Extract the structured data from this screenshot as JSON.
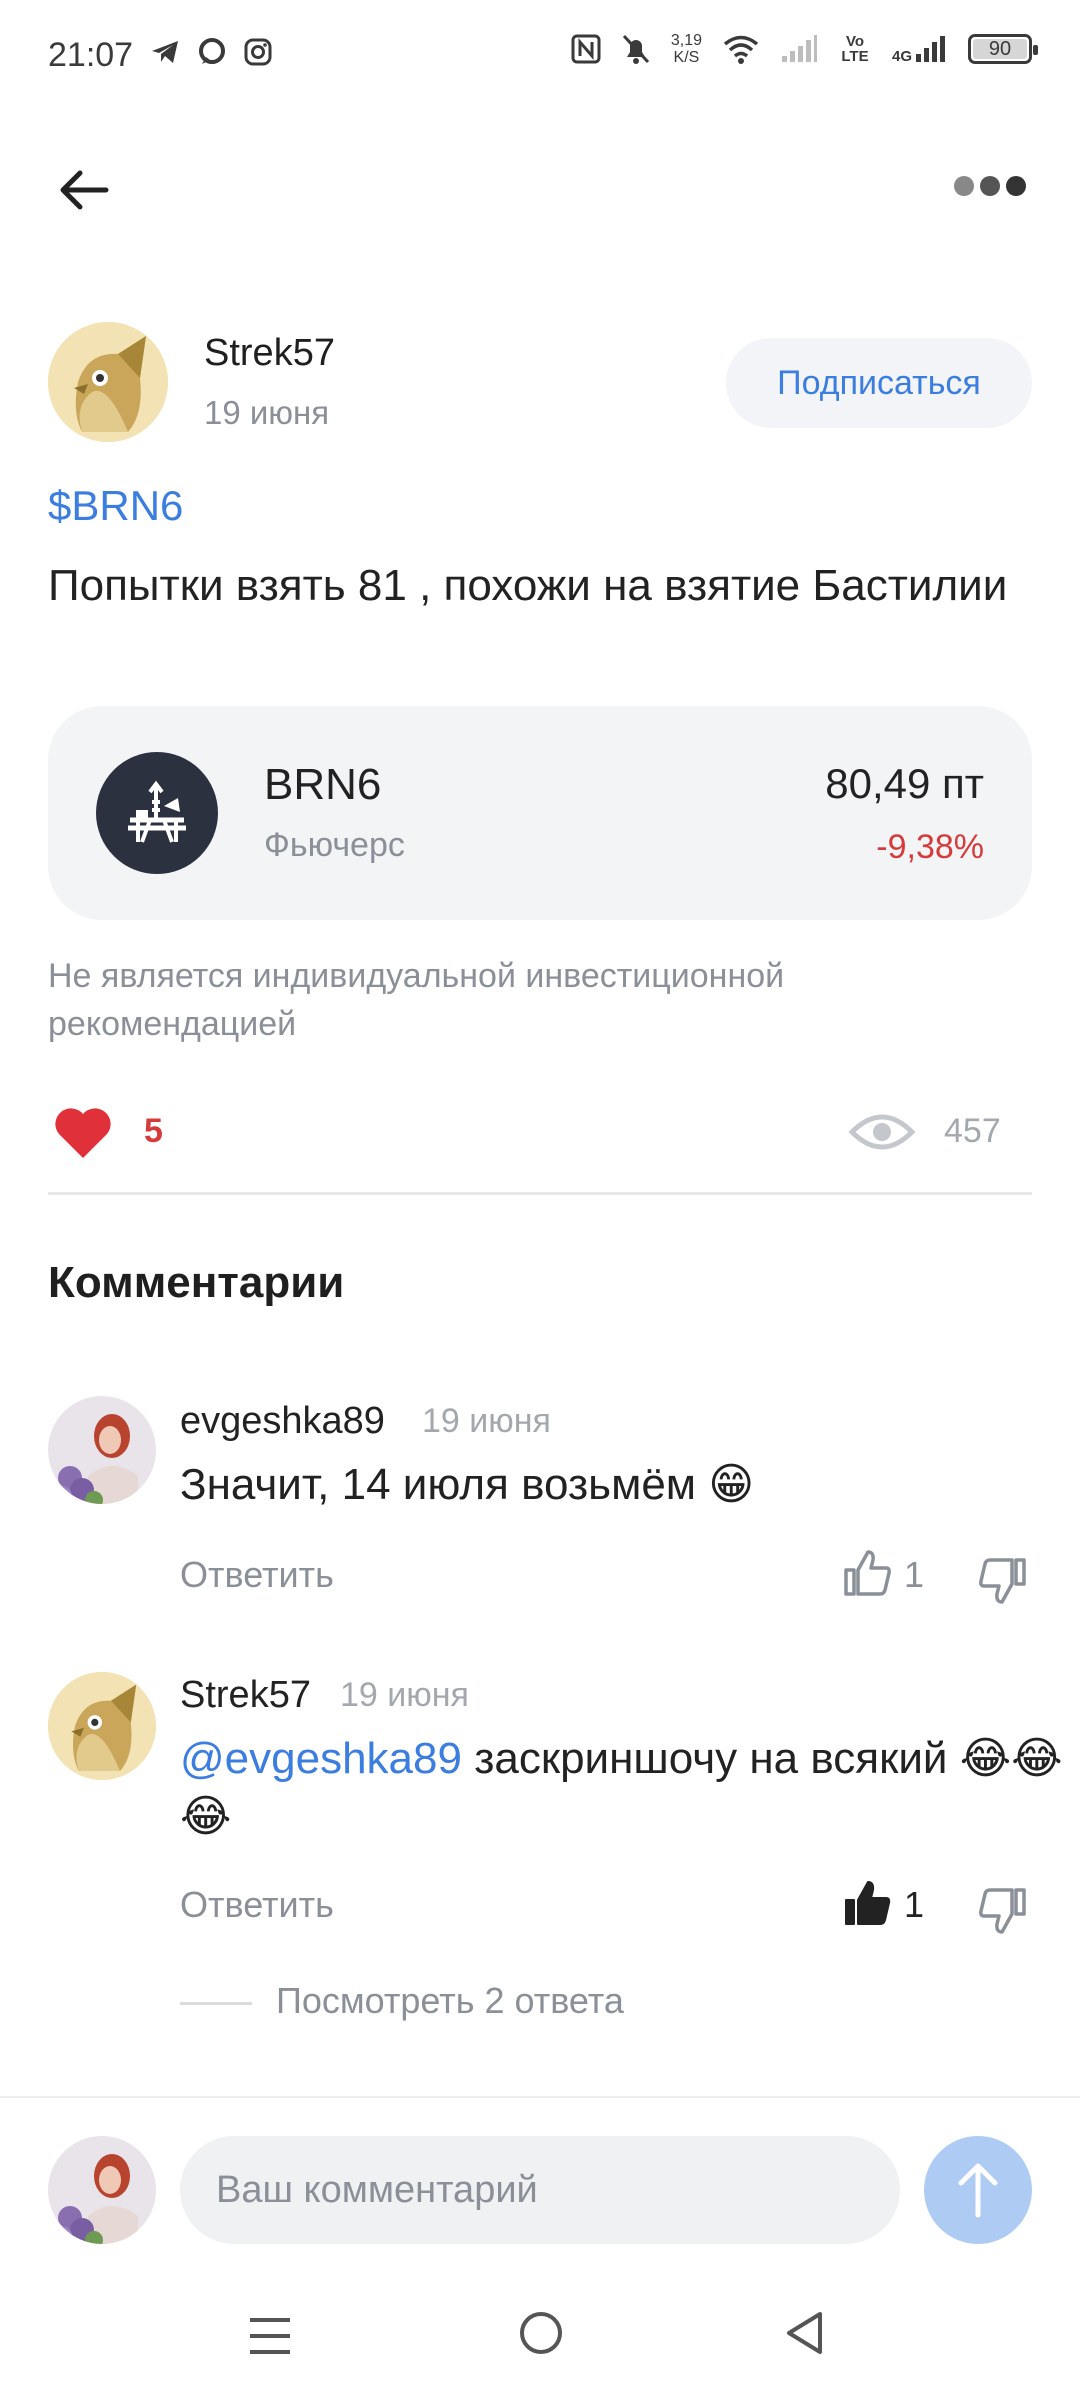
{
  "status_bar": {
    "time": "21:07",
    "speed_value": "3,19",
    "speed_unit": "K/S",
    "volte": "Vo LTE",
    "network": "4G",
    "battery": "90"
  },
  "post": {
    "author": "Strek57",
    "date": "19 июня",
    "subscribe_label": "Подписаться",
    "ticker_tag": "$BRN6",
    "text": "Попытки взять 81 , похожи на взятие Бастилии",
    "instrument": {
      "name": "BRN6",
      "type": "Фьючерс",
      "price": "80,49 пт",
      "change": "-9,38%"
    },
    "disclaimer": "Не является индивидуальной инвестиционной рекомендацией",
    "likes": "5",
    "views": "457"
  },
  "comments_title": "Комментарии",
  "comments": [
    {
      "author": "evgeshka89",
      "date": "19 июня",
      "text": "Значит, 14 июля возьмём 😁",
      "reply_label": "Ответить",
      "upvotes": "1"
    },
    {
      "author": "Strek57",
      "date": "19 июня",
      "mention": "@evgeshka89",
      "text": " заскриншочу на всякий 😂😂😂",
      "reply_label": "Ответить",
      "upvotes": "1"
    }
  ],
  "view_replies": "Посмотреть 2 ответа",
  "composer": {
    "placeholder": "Ваш комментарий"
  },
  "colors": {
    "accent": "#3c7de0",
    "negative": "#d63b3b",
    "muted": "#8a8f98"
  }
}
